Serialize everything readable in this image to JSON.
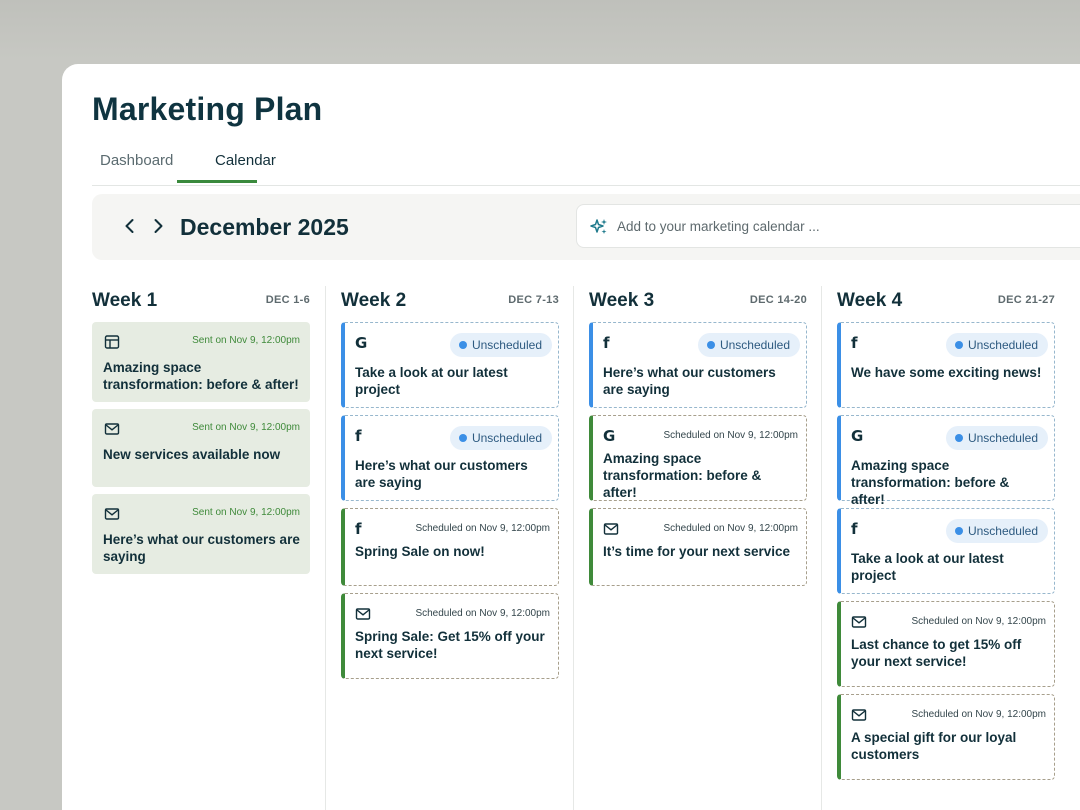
{
  "app": {
    "title": "Marketing Plan",
    "tabs": [
      {
        "label": "Dashboard",
        "active": false
      },
      {
        "label": "Calendar",
        "active": true
      }
    ]
  },
  "toolbar": {
    "prev_icon": "chevron-left-icon",
    "next_icon": "chevron-right-icon",
    "month": "December 2025",
    "search_icon": "sparkle-icon",
    "search_placeholder": "Add to your marketing calendar ..."
  },
  "colors": {
    "accent_green": "#3a8a3d",
    "unscheduled_blue": "#3b8fe6",
    "sent_background": "#e6ece2",
    "title_color": "#0f3440"
  },
  "weeks": [
    {
      "name": "Week 1",
      "range": "DEC 1-6",
      "cards": [
        {
          "status": "sent",
          "channel": "layout-icon",
          "meta": "Sent on Nov 9, 12:00pm",
          "title": "Amazing space transformation: before & after!"
        },
        {
          "status": "sent",
          "channel": "email-icon",
          "meta": "Sent on Nov 9, 12:00pm",
          "title": "New services available now"
        },
        {
          "status": "sent",
          "channel": "email-icon",
          "meta": "Sent on Nov 9, 12:00pm",
          "title": "Here’s what our customers are saying"
        }
      ]
    },
    {
      "name": "Week 2",
      "range": "DEC 7-13",
      "cards": [
        {
          "status": "unscheduled",
          "channel": "google-icon",
          "meta": "Unscheduled",
          "title": "Take a look at our latest project"
        },
        {
          "status": "unscheduled",
          "channel": "facebook-icon",
          "meta": "Unscheduled",
          "title": "Here’s what our customers are saying"
        },
        {
          "status": "scheduled",
          "channel": "facebook-icon",
          "meta": "Scheduled on Nov 9, 12:00pm",
          "title": "Spring Sale on now!"
        },
        {
          "status": "scheduled",
          "channel": "email-icon",
          "meta": "Scheduled on Nov 9, 12:00pm",
          "title": "Spring Sale: Get 15% off your next service!"
        }
      ]
    },
    {
      "name": "Week 3",
      "range": "DEC 14-20",
      "cards": [
        {
          "status": "unscheduled",
          "channel": "facebook-icon",
          "meta": "Unscheduled",
          "title": "Here’s what our customers are saying"
        },
        {
          "status": "scheduled",
          "channel": "google-icon",
          "meta": "Scheduled on Nov 9, 12:00pm",
          "title": "Amazing space transformation: before & after!"
        },
        {
          "status": "scheduled",
          "channel": "email-icon",
          "meta": "Scheduled on Nov 9, 12:00pm",
          "title": "It’s time for your next service"
        }
      ]
    },
    {
      "name": "Week 4",
      "range": "DEC 21-27",
      "cards": [
        {
          "status": "unscheduled",
          "channel": "facebook-icon",
          "meta": "Unscheduled",
          "title": "We have some exciting news!"
        },
        {
          "status": "unscheduled",
          "channel": "google-icon",
          "meta": "Unscheduled",
          "title": "Amazing space transformation: before & after!"
        },
        {
          "status": "unscheduled",
          "channel": "facebook-icon",
          "meta": "Unscheduled",
          "title": "Take a look at our latest project"
        },
        {
          "status": "scheduled",
          "channel": "email-icon",
          "meta": "Scheduled on Nov 9, 12:00pm",
          "title": "Last chance to get 15% off your next service!"
        },
        {
          "status": "scheduled",
          "channel": "email-icon",
          "meta": "Scheduled on Nov 9, 12:00pm",
          "title": "A special gift for our loyal customers"
        }
      ]
    }
  ]
}
